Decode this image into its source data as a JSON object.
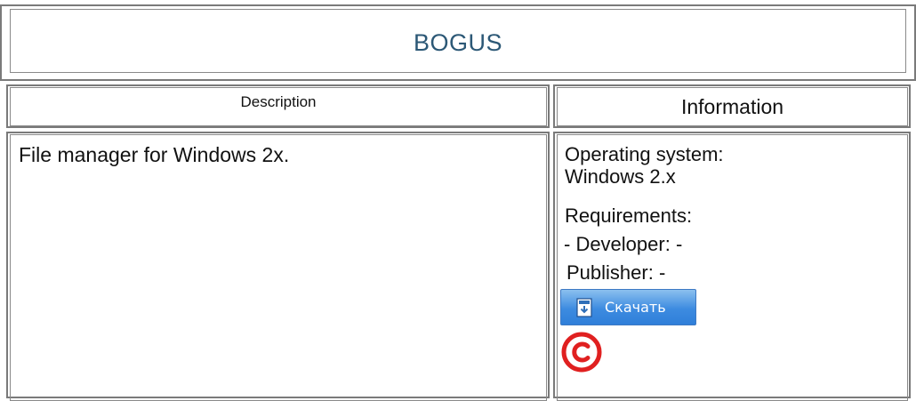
{
  "page_title": "BOGUS",
  "table": {
    "headers": {
      "description": "Description",
      "information": "Information"
    },
    "description_text": "File manager for Windows 2x.",
    "info": {
      "os_label": "Operating system:",
      "os_value": "Windows 2.x",
      "requirements": "Requirements:",
      "developer": "- Developer: -",
      "publisher": "Publisher: -"
    }
  },
  "download_button": {
    "label": "Скачать",
    "icon": "download-icon"
  },
  "copyright_icon": "copyright-icon",
  "colors": {
    "title": "#2c5876",
    "button": "#3d8be0",
    "copyright": "#e02020"
  }
}
